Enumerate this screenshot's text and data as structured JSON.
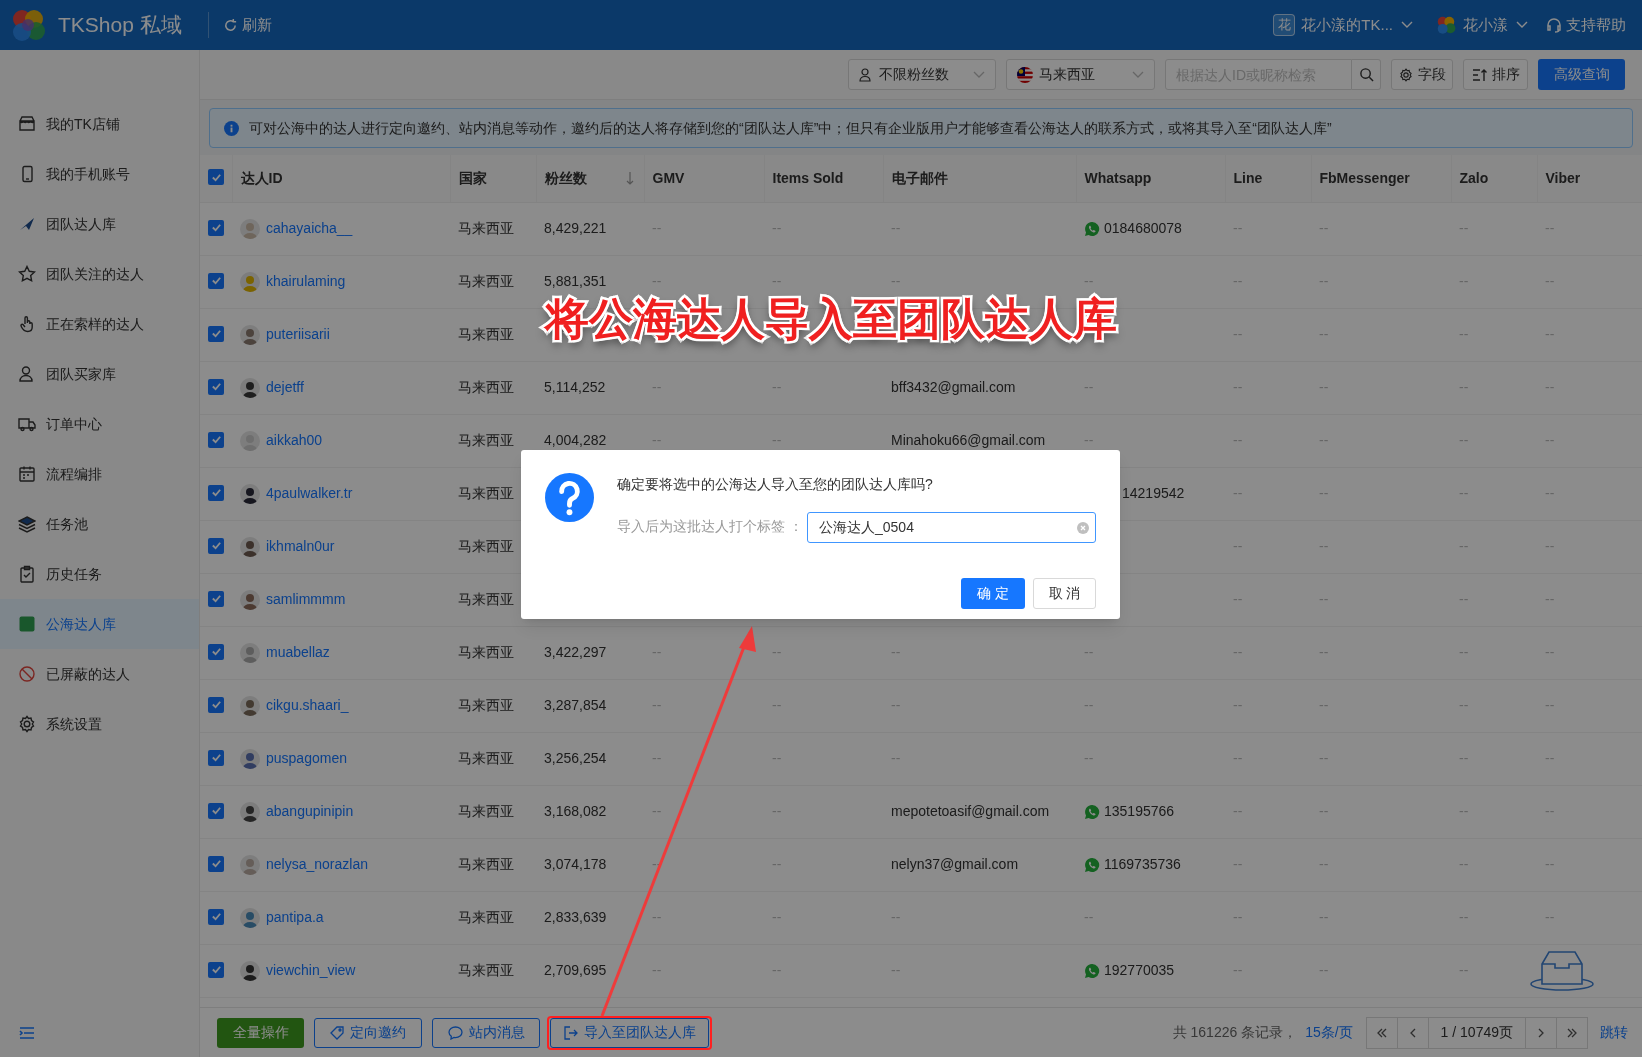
{
  "header": {
    "brand": "TKShop 私域",
    "refresh": "刷新",
    "account_badge": "花",
    "account": "花小漾的TK...",
    "user": "花小漾",
    "help": "支持帮助"
  },
  "sidebar": {
    "items": [
      {
        "label": "我的TK店铺",
        "selected": false
      },
      {
        "label": "我的手机账号",
        "selected": false
      },
      {
        "label": "团队达人库",
        "selected": false
      },
      {
        "label": "团队关注的达人",
        "selected": false
      },
      {
        "label": "正在索样的达人",
        "selected": false
      },
      {
        "label": "团队买家库",
        "selected": false
      },
      {
        "label": "订单中心",
        "selected": false
      },
      {
        "label": "流程编排",
        "selected": false
      },
      {
        "label": "任务池",
        "selected": false
      },
      {
        "label": "历史任务",
        "selected": false
      },
      {
        "label": "公海达人库",
        "selected": true
      },
      {
        "label": "已屏蔽的达人",
        "selected": false
      },
      {
        "label": "系统设置",
        "selected": false
      }
    ]
  },
  "toolbar": {
    "followers_filter": "不限粉丝数",
    "country_filter": "马来西亚",
    "search_placeholder": "根据达人ID或昵称检索",
    "fields_button": "字段",
    "sort_button": "排序",
    "advanced_button": "高级查询"
  },
  "notice": "可对公海中的达人进行定向邀约、站内消息等动作，邀约后的达人将存储到您的“团队达人库”中；但只有企业版用户才能够查看公海达人的联系方式，或将其导入至“团队达人库”",
  "table": {
    "all_checked": true,
    "columns": [
      {
        "label": "达人ID"
      },
      {
        "label": "国家"
      },
      {
        "label": "粉丝数",
        "sorted": true
      },
      {
        "label": "GMV"
      },
      {
        "label": "Items Sold"
      },
      {
        "label": "电子邮件"
      },
      {
        "label": "Whatsapp"
      },
      {
        "label": "Line"
      },
      {
        "label": "FbMessenger"
      },
      {
        "label": "Zalo"
      },
      {
        "label": "Viber"
      }
    ],
    "rows": [
      {
        "checked": true,
        "id": "cahayaicha__",
        "country": "马来西亚",
        "followers": "8,429,221",
        "gmv": "--",
        "items_sold": "--",
        "email": "--",
        "whatsapp": "0184680078",
        "kind": "verified",
        "line": "--",
        "fbmessenger": "--",
        "zalo": "--",
        "viber": "--"
      },
      {
        "checked": true,
        "id": "khairulaming",
        "country": "马来西亚",
        "followers": "5,881,351",
        "gmv": "--",
        "items_sold": "--",
        "email": "--",
        "whatsapp": "--",
        "kind": "empty",
        "line": "--",
        "fbmessenger": "--",
        "zalo": "--",
        "viber": "--"
      },
      {
        "checked": true,
        "id": "puteriisarii",
        "country": "马来西亚",
        "line": "--",
        "fbmessenger": "--",
        "zalo": "--",
        "viber": "--"
      },
      {
        "checked": true,
        "id": "dejetff",
        "country": "马来西亚",
        "followers": "5,114,252",
        "gmv": "--",
        "items_sold": "--",
        "email": "bff3432@gmail.com",
        "whatsapp": "--",
        "kind": "empty",
        "line": "--",
        "fbmessenger": "--",
        "zalo": "--",
        "viber": "--"
      },
      {
        "checked": true,
        "id": "aikkah00",
        "country": "马来西亚",
        "followers": "4,004,282",
        "gmv": "--",
        "items_sold": "--",
        "email": "Minahoku66@gmail.com",
        "whatsapp": "--",
        "kind": "empty",
        "line": "--",
        "fbmessenger": "--",
        "zalo": "--",
        "viber": "--"
      },
      {
        "checked": true,
        "id": "4paulwalker.tr",
        "country": "马来西亚",
        "whatsapp": "14219542",
        "kind": "number",
        "line": "--",
        "fbmessenger": "--",
        "zalo": "--",
        "viber": "--"
      },
      {
        "checked": true,
        "id": "ikhmaln0ur",
        "country": "马来西亚",
        "line": "--",
        "fbmessenger": "--",
        "zalo": "--",
        "viber": "--"
      },
      {
        "checked": true,
        "id": "samlimmmm",
        "country": "马来西亚",
        "line": "--",
        "fbmessenger": "--",
        "zalo": "--",
        "viber": "--"
      },
      {
        "checked": true,
        "id": "muabellaz",
        "country": "马来西亚",
        "followers": "3,422,297",
        "gmv": "--",
        "items_sold": "--",
        "email": "--",
        "whatsapp": "--",
        "kind": "empty",
        "line": "--",
        "fbmessenger": "--",
        "zalo": "--",
        "viber": "--"
      },
      {
        "checked": true,
        "id": "cikgu.shaari_",
        "country": "马来西亚",
        "followers": "3,287,854",
        "gmv": "--",
        "items_sold": "--",
        "email": "--",
        "whatsapp": "--",
        "kind": "empty",
        "line": "--",
        "fbmessenger": "--",
        "zalo": "--",
        "viber": "--"
      },
      {
        "checked": true,
        "id": "puspagomen",
        "country": "马来西亚",
        "followers": "3,256,254",
        "gmv": "--",
        "items_sold": "--",
        "email": "--",
        "whatsapp": "--",
        "kind": "empty",
        "line": "--",
        "fbmessenger": "--",
        "zalo": "--",
        "viber": "--"
      },
      {
        "checked": true,
        "id": "abangupinipin",
        "country": "马来西亚",
        "followers": "3,168,082",
        "gmv": "--",
        "items_sold": "--",
        "email": "mepotetoasif@gmail.com",
        "whatsapp": "135195766",
        "kind": "verified",
        "line": "--",
        "fbmessenger": "--",
        "zalo": "--",
        "viber": "--"
      },
      {
        "checked": true,
        "id": "nelysa_norazlan",
        "country": "马来西亚",
        "followers": "3,074,178",
        "gmv": "--",
        "items_sold": "--",
        "email": "nelyn37@gmail.com",
        "whatsapp": "1169735736",
        "kind": "verified",
        "line": "--",
        "fbmessenger": "--",
        "zalo": "--",
        "viber": "--"
      },
      {
        "checked": true,
        "id": "pantipa.a",
        "country": "马来西亚",
        "followers": "2,833,639",
        "gmv": "--",
        "items_sold": "--",
        "email": "--",
        "whatsapp": "--",
        "kind": "empty",
        "line": "--",
        "fbmessenger": "--",
        "zalo": "--",
        "viber": "--"
      },
      {
        "checked": true,
        "id": "viewchin_view",
        "country": "马来西亚",
        "followers": "2,709,695",
        "gmv": "--",
        "items_sold": "--",
        "email": "--",
        "whatsapp": "192770035",
        "kind": "verified",
        "line": "--",
        "fbmessenger": "--",
        "zalo": "--"
      }
    ]
  },
  "footer": {
    "buttons": [
      {
        "kind": "primary",
        "label": "全量操作"
      },
      {
        "kind": "invite",
        "label": "定向邀约"
      },
      {
        "kind": "message",
        "label": "站内消息"
      },
      {
        "kind": "import",
        "label": "导入至团队达人库"
      }
    ],
    "total": "共 161226 条记录，",
    "page_size": "15条/页",
    "page": "1 / 10749页",
    "jump": "跳转"
  },
  "annotation": "将公海达人导入至团队达人库",
  "dialog": {
    "question": "确定要将选中的公海达人导入至您的团队达人库吗?",
    "tag_label": "导入后为这批达人打个标签 ：",
    "tag_value": "公海达人_0504",
    "ok": "确 定",
    "cancel": "取 消"
  }
}
